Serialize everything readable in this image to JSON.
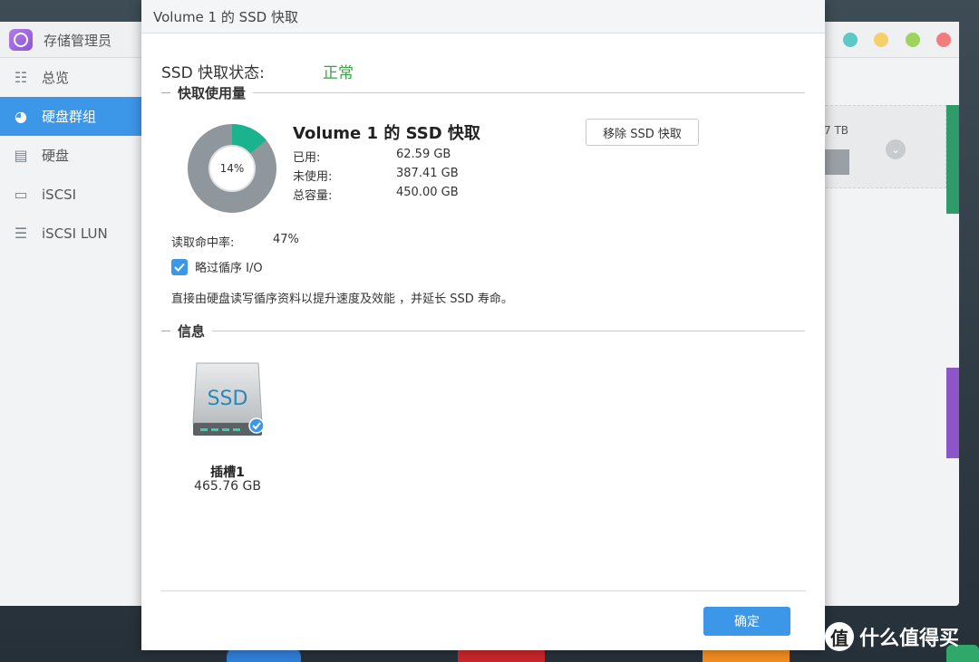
{
  "background_app": {
    "title": "存储管理员",
    "sidebar": [
      {
        "label": "总览",
        "icon": "overview-icon"
      },
      {
        "label": "硬盘群组",
        "icon": "disk-group-icon",
        "active": true
      },
      {
        "label": "硬盘",
        "icon": "hdd-icon"
      },
      {
        "label": "iSCSI",
        "icon": "iscsi-icon"
      },
      {
        "label": "iSCSI LUN",
        "icon": "iscsi-lun-icon"
      }
    ],
    "panel_text": "7 TB"
  },
  "dialog": {
    "title": "Volume 1 的 SSD 快取",
    "status_label": "SSD 快取状态:",
    "status_value": "正常",
    "usage_section": "快取使用量",
    "donut_percent": "14%",
    "donut_fraction": 0.14,
    "volume_title": "Volume 1 的 SSD 快取",
    "used_label": "已用:",
    "used_value": "62.59 GB",
    "unused_label": "未使用:",
    "unused_value": "387.41 GB",
    "total_label": "总容量:",
    "total_value": "450.00 GB",
    "remove_button": "移除 SSD 快取",
    "hit_rate_label": "读取命中率:",
    "hit_rate_value": "47%",
    "skip_sequential_label": "略过循序 I/O",
    "skip_sequential_checked": true,
    "description": "直接由硬盘读写循序资料以提升速度及效能 ，并延长 SSD 寿命。",
    "info_section": "信息",
    "ssd_label": "SSD",
    "slot_name": "插槽1",
    "slot_size": "465.76 GB",
    "ok_button": "确定"
  },
  "watermark": {
    "logo": "值",
    "text": "什么值得买"
  },
  "colors": {
    "accent": "#3d97e8",
    "status_ok": "#3aa345",
    "donut_used": "#1bb38e",
    "donut_free": "#8f979c"
  }
}
